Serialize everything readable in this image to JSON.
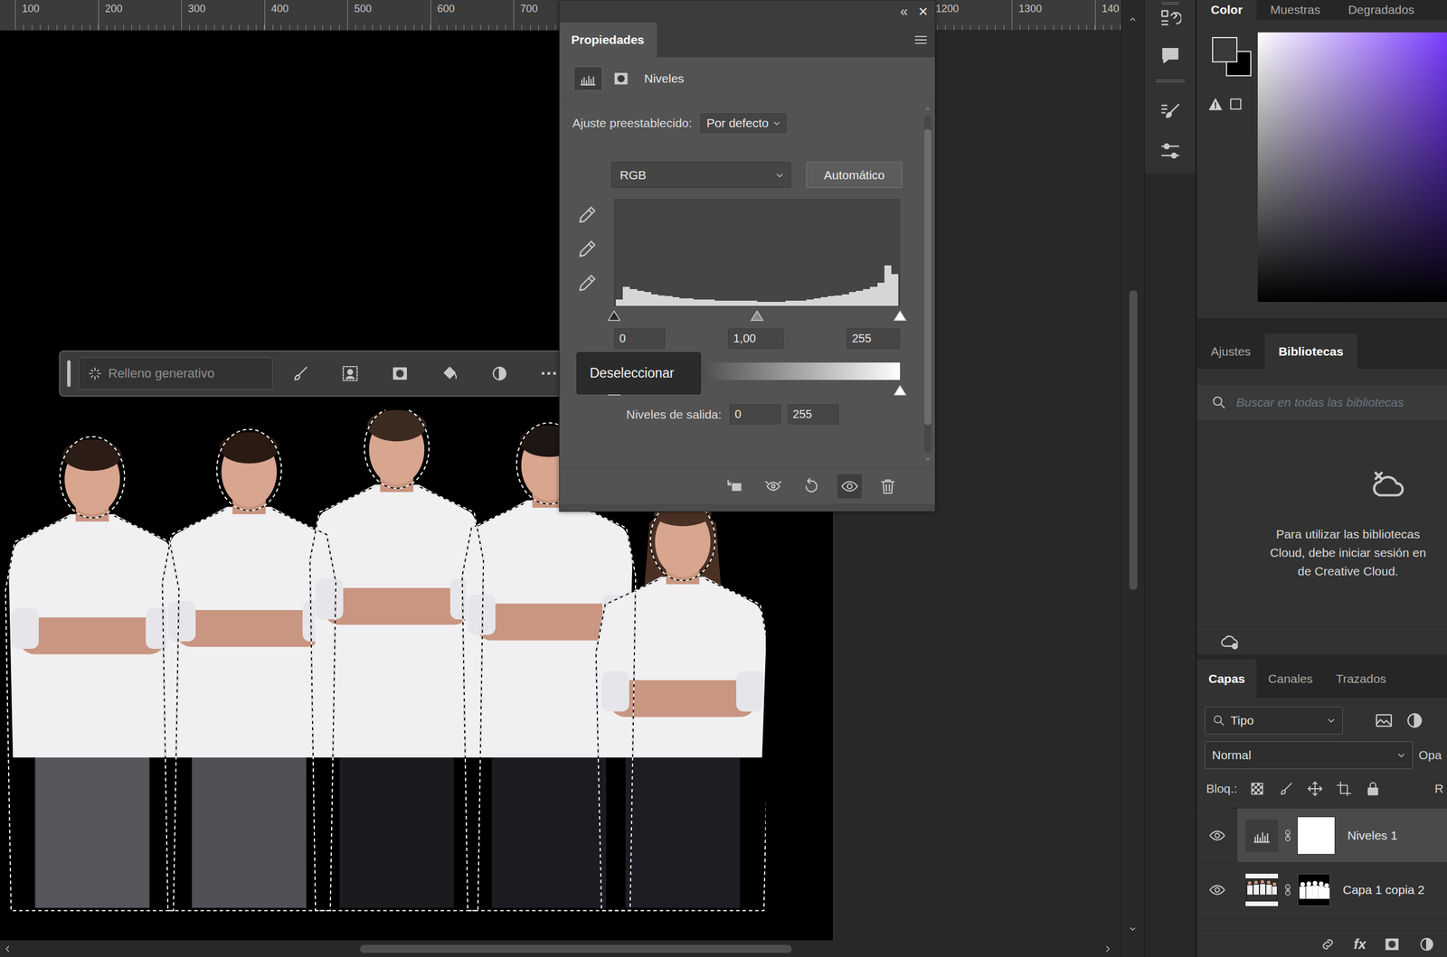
{
  "rulers": {
    "top": [
      "100",
      "200",
      "300",
      "400",
      "500",
      "600",
      "700",
      "1200",
      "1300",
      "140"
    ]
  },
  "canvas": {
    "selection_active": true
  },
  "taskbar": {
    "generative_fill": "Relleno generativo",
    "more": "···",
    "tooltip": "Deseleccionar"
  },
  "properties": {
    "collapse": "«",
    "close": "×",
    "title": "Propiedades",
    "adjustment": "Niveles",
    "preset_label": "Ajuste preestablecido:",
    "preset": "Por defecto",
    "channel": "RGB",
    "auto_button": "Automático",
    "histogram": {
      "values": [
        6,
        18,
        16,
        14,
        13,
        11,
        10,
        9,
        8,
        7,
        7,
        6,
        6,
        6,
        5,
        5,
        5,
        5,
        5,
        5,
        4,
        4,
        4,
        4,
        5,
        5,
        5,
        6,
        7,
        8,
        9,
        10,
        11,
        13,
        14,
        16,
        18,
        22,
        38,
        30
      ]
    },
    "input": {
      "black": "0",
      "gamma": "1,00",
      "white": "255"
    },
    "output_label": "Niveles de salida:",
    "output": {
      "black": "0",
      "white": "255"
    }
  },
  "color_panel": {
    "tabs": [
      {
        "label": "Color",
        "selected": true
      },
      {
        "label": "Muestras",
        "selected": false
      },
      {
        "label": "Degradados",
        "selected": false
      }
    ],
    "foreground": "#3a3a3a",
    "background": "#000000",
    "hue": "#7a3cff"
  },
  "libraries_panel": {
    "tabs": [
      {
        "label": "Ajustes",
        "selected": false
      },
      {
        "label": "Bibliotecas",
        "selected": true
      }
    ],
    "search": {
      "placeholder": "Buscar en todas las bibliotecas"
    },
    "message_lines": [
      "Para utilizar las bibliotecas",
      "Cloud, debe iniciar sesión en",
      "de Creative Cloud."
    ]
  },
  "layers_panel": {
    "tabs": [
      {
        "label": "Capas",
        "selected": true
      },
      {
        "label": "Canales",
        "selected": false
      },
      {
        "label": "Trazados",
        "selected": false
      }
    ],
    "filter": "Tipo",
    "blend_mode": "Normal",
    "opacity_label": "Opa",
    "lock_label": "Bloq.:",
    "fill_label": "R",
    "fx_label": "fx",
    "layers": [
      {
        "name": "Niveles 1",
        "kind": "adjustment",
        "visible": true,
        "selected": true
      },
      {
        "name": "Capa 1 copia 2",
        "kind": "pixel",
        "visible": true,
        "selected": false
      }
    ]
  }
}
